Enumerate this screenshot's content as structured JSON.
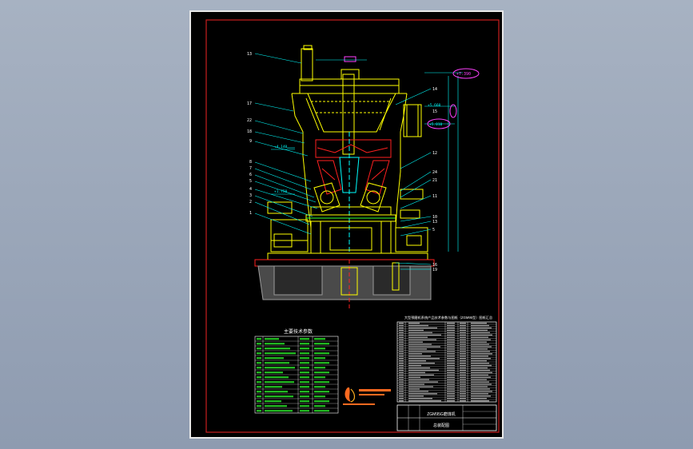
{
  "tech_params": {
    "title": "主要技术参数"
  },
  "title_block": {
    "header": "大型预磨机系统产品技术参数与图纸（ZGM95型）图纸汇总",
    "drawing_name": "ZGM95G磨煤机",
    "sub_name": "总装配图"
  },
  "labels": {
    "elev_top": "+7.390",
    "elev_mid1": "+5.660",
    "elev_mid2": "+5.010",
    "elev_left1": "+4.140",
    "elev_left2": "+1.750"
  },
  "part_numbers": [
    "13",
    "17",
    "22",
    "18",
    "9",
    "8",
    "7",
    "6",
    "5",
    "4",
    "3",
    "2",
    "1",
    "14",
    "15",
    "12",
    "24",
    "21",
    "11",
    "10",
    "13",
    "5",
    "16",
    "19"
  ],
  "colors": {
    "sheet": "#000000",
    "frame": "#c81e1e",
    "yellow": "#ffff00",
    "cyan": "#00ffff",
    "magenta": "#ff40ff",
    "red": "#ff2020",
    "white": "#ffffff",
    "green": "#30ff30"
  }
}
